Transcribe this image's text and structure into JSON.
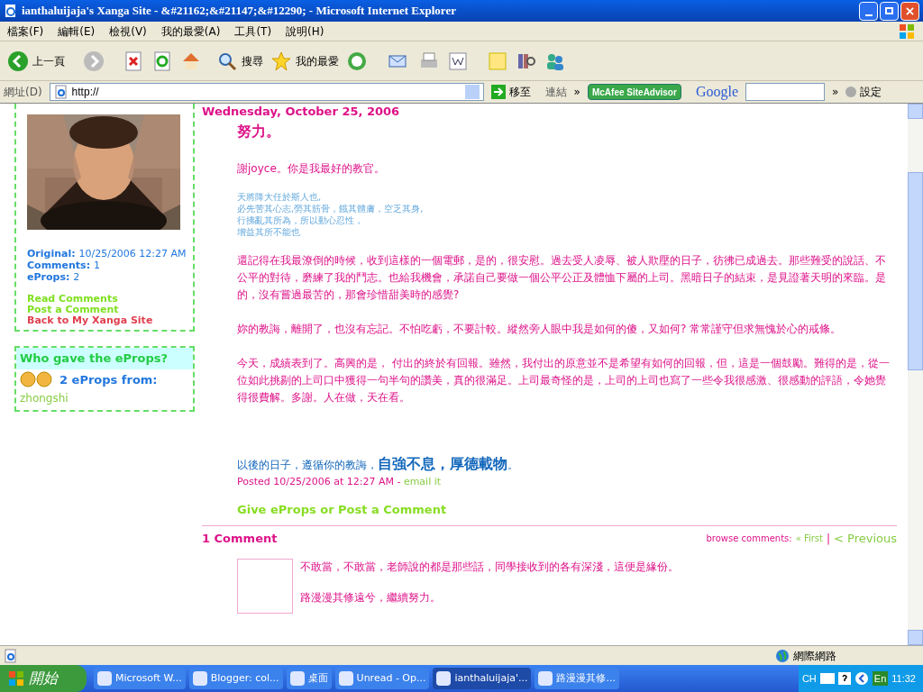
{
  "window": {
    "title": "ianthaluijaja's Xanga Site - &#21162;&#21147;&#12290; - Microsoft Internet Explorer"
  },
  "menu": [
    "檔案(F)",
    "編輯(E)",
    "檢視(V)",
    "我的最愛(A)",
    "工具(T)",
    "說明(H)"
  ],
  "toolbar": {
    "back": "上一頁",
    "search": "搜尋",
    "favorites": "我的最愛"
  },
  "address": {
    "label": "網址(D)",
    "value": "http://",
    "go": "移至",
    "links": "連結",
    "chevron": "»",
    "siteadvisor": "McAfee SiteAdvisor",
    "google": "Google",
    "chevron2": "»",
    "settings": "設定"
  },
  "sidebar": {
    "meta": [
      {
        "label": "Original:",
        "value": "10/25/2006 12:27 AM"
      },
      {
        "label": "Comments:",
        "value": "1"
      },
      {
        "label": "eProps:",
        "value": "2"
      }
    ],
    "links": [
      {
        "text": "Read Comments",
        "color": "#80e020"
      },
      {
        "text": "Post a Comment",
        "color": "#80e020"
      },
      {
        "text": "Back to My Xanga Site",
        "color": "#e04050"
      }
    ],
    "eprops": {
      "title": "Who gave the eProps?",
      "count": "2 eProps from:",
      "from": "zhongshi"
    }
  },
  "post": {
    "date": "Wednesday, October 25, 2006",
    "title": "努力。",
    "thanks": "謝joyce。你是我最好的教官。",
    "quote": [
      "天將降大任於斯人也,",
      "必先苦其心志,勞其筋骨，餓其體膚，空乏其身,",
      "行拂亂其所為，所以動心忍性，",
      "增益其所不能也"
    ],
    "paragraphs": [
      "還記得在我最潦倒的時候，收到這樣的一個電郵，是的，很安慰。過去受人凌辱、被人欺壓的日子，彷彿已成過去。那些難受的說話、不公平的對待，磨練了我的鬥志。也給我機會，承諾自己要做一個公平公正及體恤下屬的上司。黑暗日子的結束，是見證著天明的來臨。是的，沒有嘗過最苦的，那會珍惜甜美時的感覺?",
      "妳的教誨，離開了，也沒有忘記。不怕吃虧，不要計較。縱然旁人眼中我是如何的傻，又如何? 常常謹守但求無愧於心的戒條。",
      "今天，成績表到了。高興的是， 付出的終於有回報。雖然，我付出的原意並不是希望有如何的回報，但，這是一個鼓勵。難得的是，從一位如此挑剔的上司口中獲得一句半句的讚美，真的很滿足。上司最奇怪的是，上司的上司也寫了一些令我很感激、很感動的評語，令她覺得很費解。多謝。人在做，天在看。"
    ],
    "closing": "以後的日子，遵循你的教誨，**自強不息，厚德載物**。",
    "posted": "Posted 10/25/2006 at 12:27 AM -",
    "email": "email it",
    "give": "Give eProps or Post a Comment"
  },
  "comments": {
    "heading": "1 Comment",
    "browse": "browse comments:",
    "first": "« First",
    "sep": "|",
    "previous": "< Previous",
    "items": [
      {
        "lines": [
          "不敢當，不敢當，老師說的都是那些話，同學接收到的各有深淺，這便是緣份。",
          "路漫漫其修遠兮，繼續努力。"
        ]
      }
    ]
  },
  "status_bar": {
    "zone": "網際網路"
  },
  "taskbar": {
    "start": "開始",
    "tasks": [
      {
        "label": "Microsoft W...",
        "selected": false
      },
      {
        "label": "Blogger: col...",
        "selected": false
      },
      {
        "label": "桌面",
        "selected": false
      },
      {
        "label": "Unread - Op...",
        "selected": false
      },
      {
        "label": "ianthaluijaja'...",
        "selected": true
      },
      {
        "label": "路漫漫其修...",
        "selected": false
      }
    ],
    "lang": "CH",
    "ime": "En",
    "time": "11:32"
  }
}
